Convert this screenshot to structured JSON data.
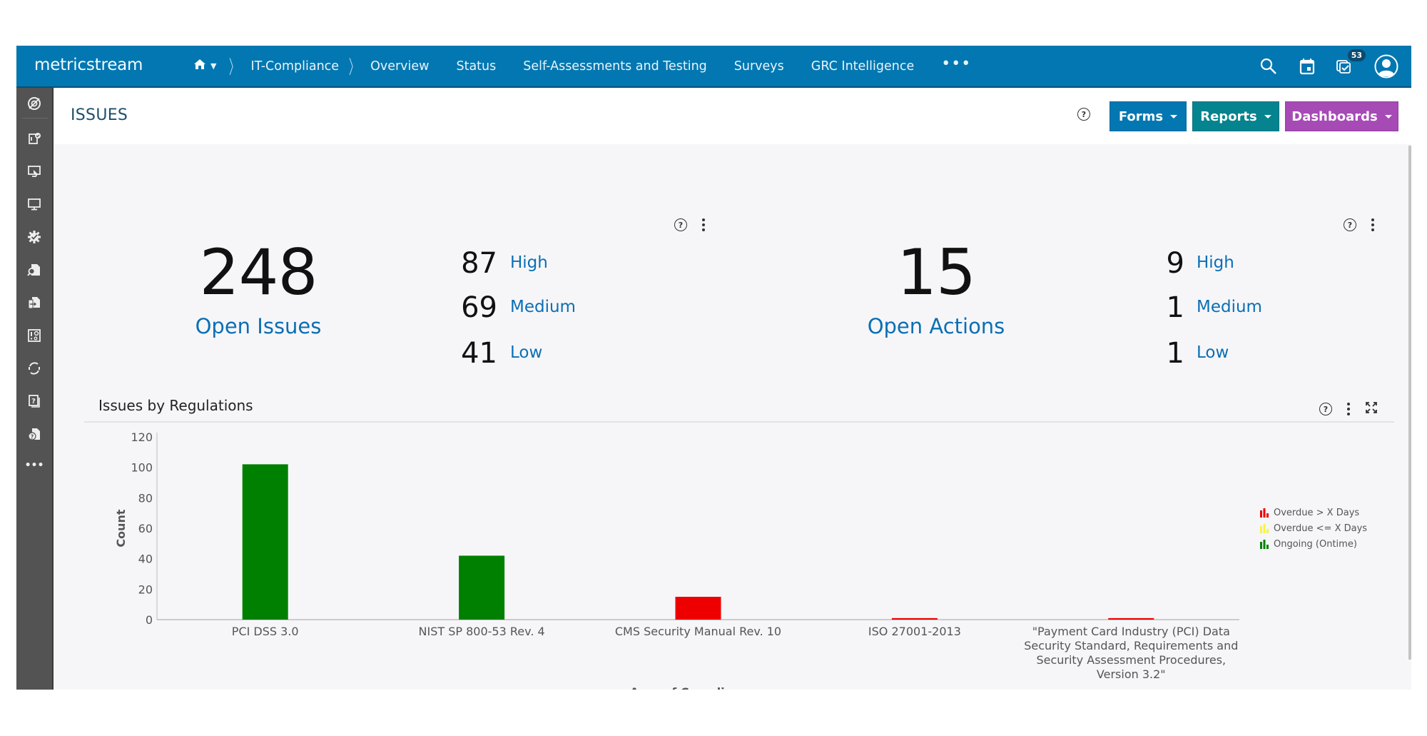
{
  "app": {
    "logo": "metricstream",
    "breadcrumb": {
      "home_icon": "home-icon",
      "module": "IT-Compliance"
    },
    "nav_items": [
      "Overview",
      "Status",
      "Self-Assessments and Testing",
      "Surveys",
      "GRC Intelligence"
    ],
    "nav_more": "•••",
    "notifications_count": "53",
    "top_icons": [
      "search-icon",
      "calendar-icon",
      "tasks-icon",
      "user-avatar-icon"
    ]
  },
  "sidebar": {
    "items": [
      "compass-icon",
      "document-check-icon",
      "monitor-touch-icon",
      "desktop-icon",
      "gear-check-icon",
      "document-search-icon",
      "documents-sync-icon",
      "alert-settings-icon",
      "refresh-icon",
      "question-pages-icon",
      "document-question-icon"
    ],
    "more": "•••"
  },
  "header": {
    "title": "ISSUES",
    "buttons": {
      "forms": "Forms",
      "reports": "Reports",
      "dashboards": "Dashboards"
    },
    "colors": {
      "forms": "#0377b1",
      "reports": "#05838f",
      "dashboards": "#a64ab6"
    }
  },
  "issues_widget": {
    "total": "248",
    "total_label": "Open Issues",
    "severity": [
      {
        "count": "87",
        "label": "High"
      },
      {
        "count": "69",
        "label": "Medium"
      },
      {
        "count": "41",
        "label": "Low"
      }
    ]
  },
  "actions_widget": {
    "total": "15",
    "total_label": "Open Actions",
    "severity": [
      {
        "count": "9",
        "label": "High"
      },
      {
        "count": "1",
        "label": "Medium"
      },
      {
        "count": "1",
        "label": "Low"
      }
    ]
  },
  "chart_section": {
    "title": "Issues by Regulations"
  },
  "chart_data": {
    "type": "bar",
    "title": "Issues by Regulations",
    "xlabel": "Area of Compliance",
    "ylabel": "Count",
    "ylim": [
      0,
      120
    ],
    "yticks": [
      0,
      20,
      40,
      60,
      80,
      100,
      120
    ],
    "grid": false,
    "legend_position": "right",
    "categories": [
      "PCI DSS 3.0",
      "NIST SP 800-53 Rev. 4",
      "CMS Security Manual Rev. 10",
      "ISO 27001-2013",
      "\"Payment Card Industry (PCI) Data Security Standard, Requirements and Security Assessment Procedures, Version 3.2\""
    ],
    "category_lines": [
      [
        "PCI DSS 3.0"
      ],
      [
        "NIST SP 800-53 Rev. 4"
      ],
      [
        "CMS Security Manual Rev. 10"
      ],
      [
        "ISO 27001-2013"
      ],
      [
        "\"Payment Card Industry (PCI) Data",
        "Security Standard, Requirements and",
        "Security Assessment Procedures,",
        "Version 3.2\""
      ]
    ],
    "series": [
      {
        "name": "Overdue > X Days",
        "color": "#ee0000",
        "values": [
          0,
          0,
          15,
          1,
          1
        ]
      },
      {
        "name": "Overdue <= X Days",
        "color": "#f5f542",
        "values": [
          0,
          0,
          0,
          0,
          0
        ]
      },
      {
        "name": "Ongoing (Ontime)",
        "color": "#008000",
        "values": [
          102,
          42,
          0,
          0,
          0
        ]
      }
    ]
  }
}
